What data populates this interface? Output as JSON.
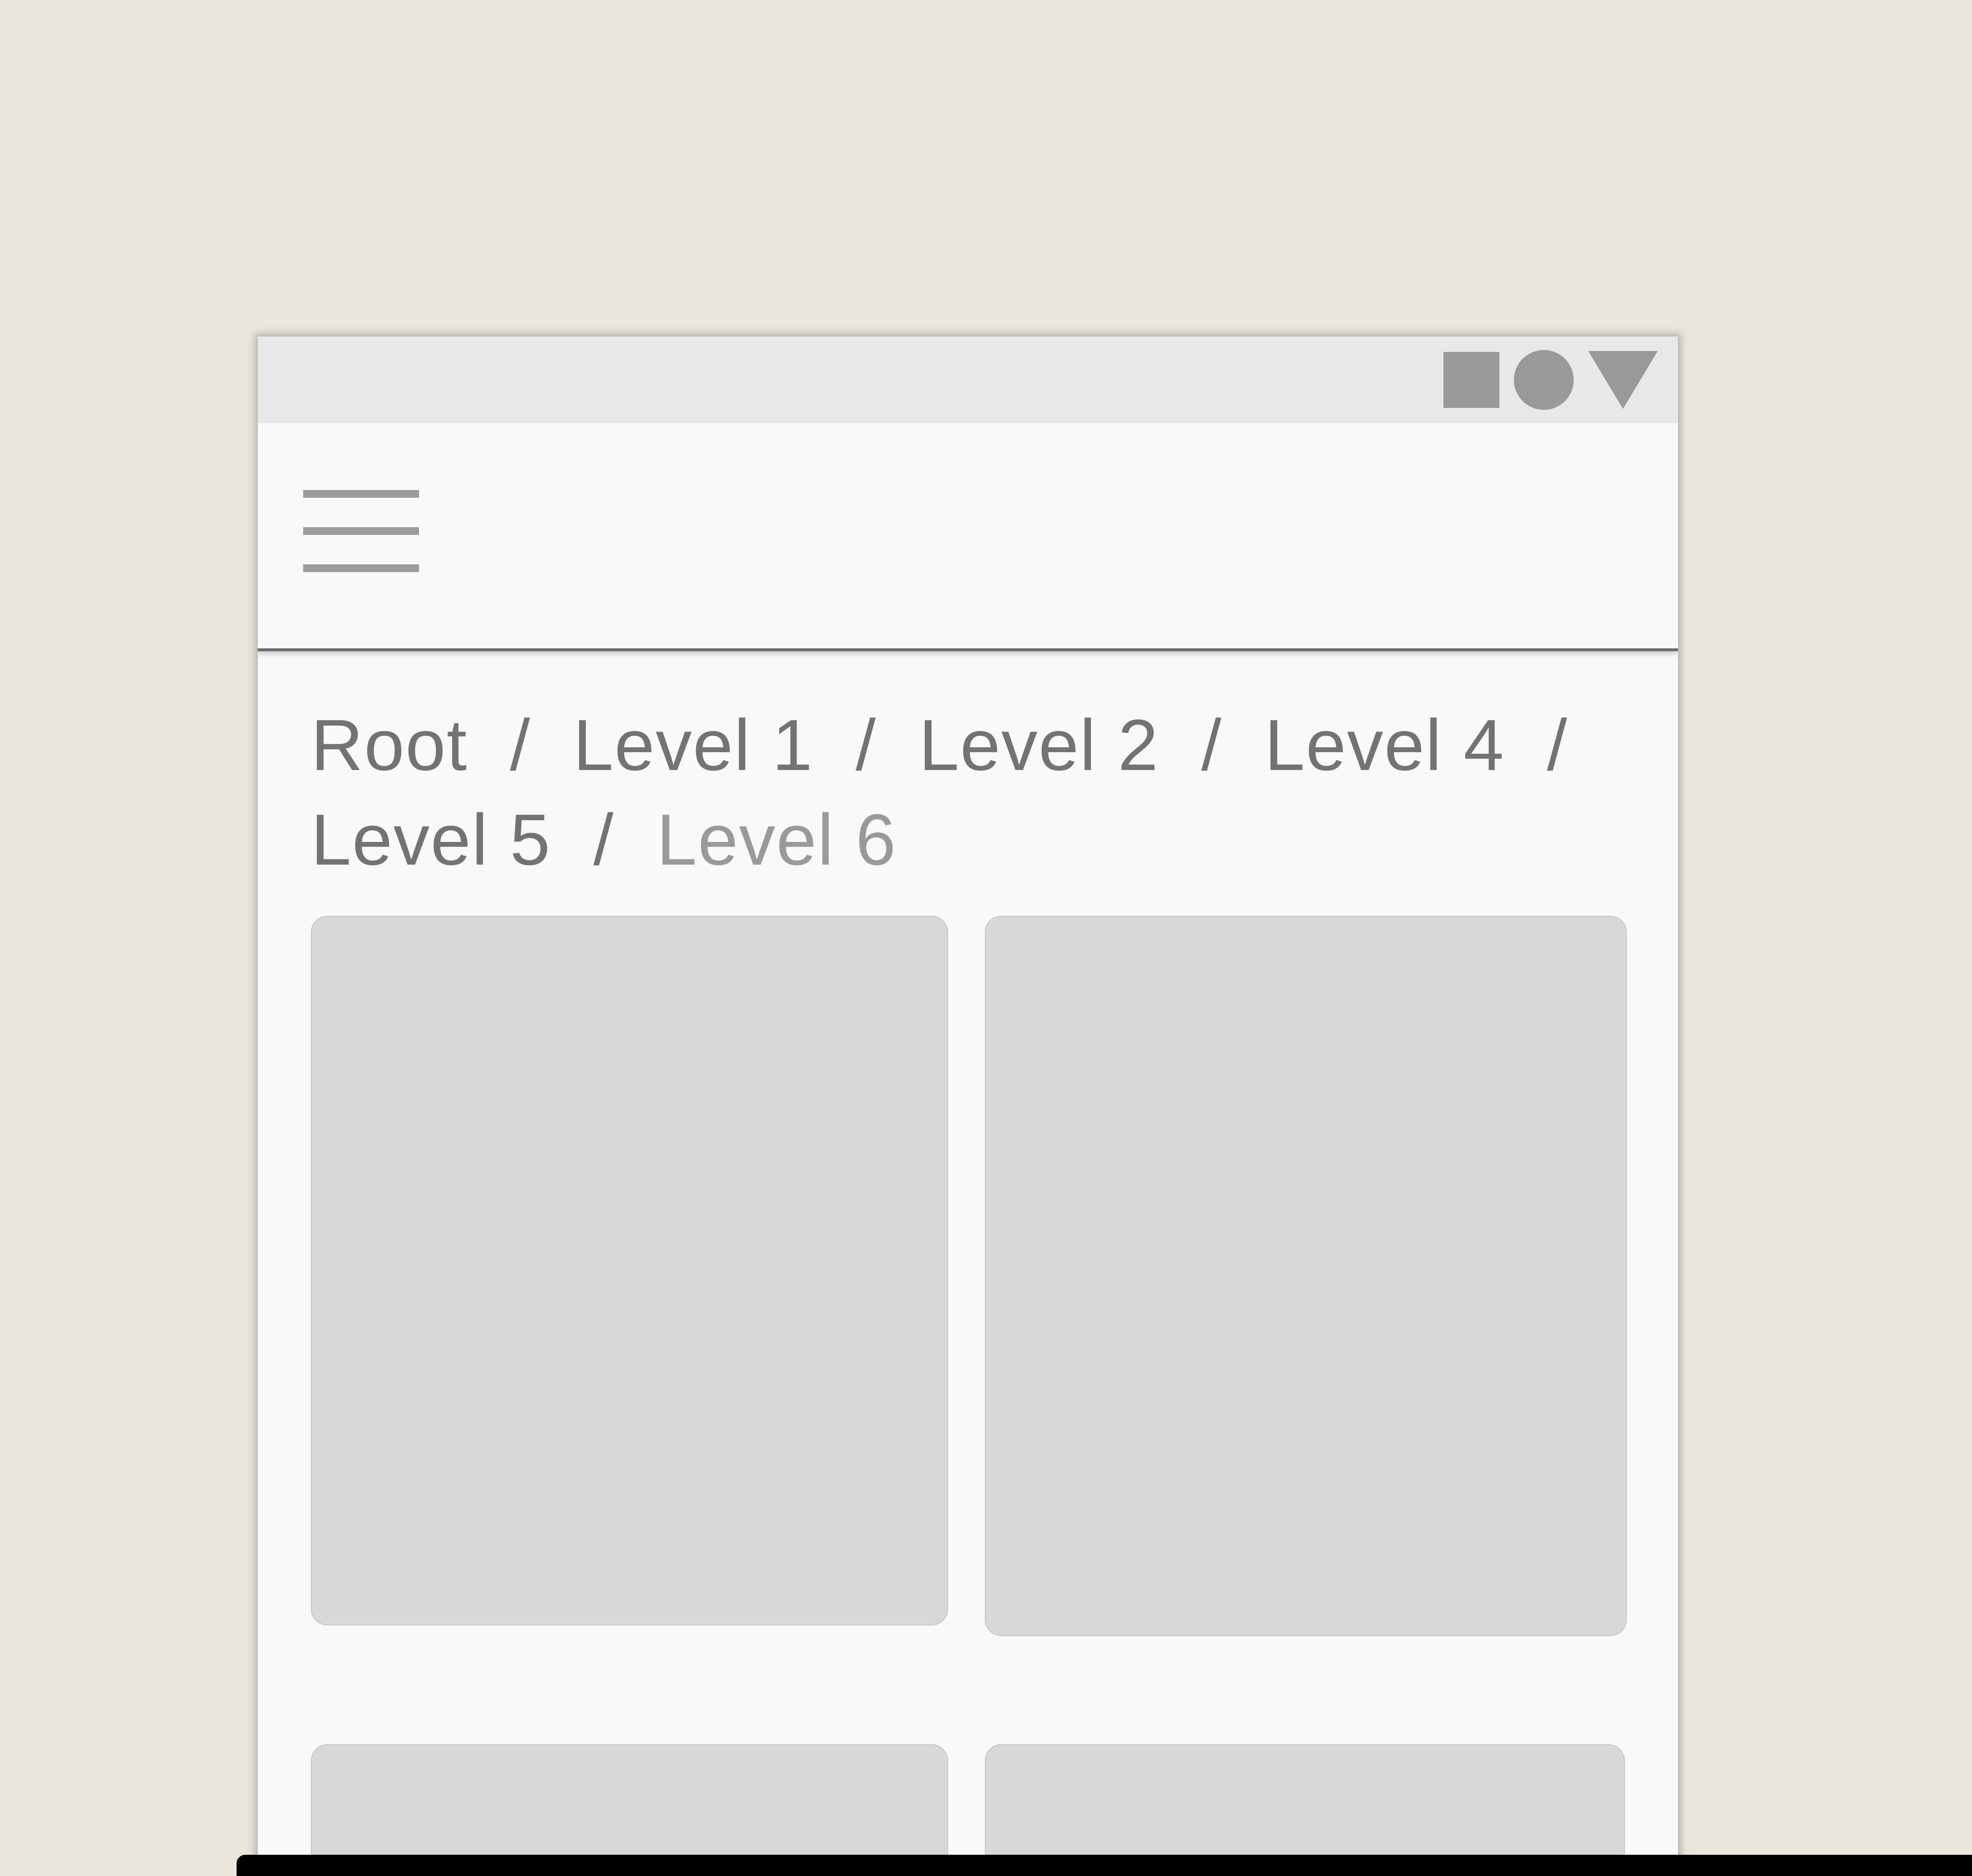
{
  "status_bar": {
    "icons": [
      "square-icon",
      "circle-icon",
      "triangle-icon"
    ],
    "icon_color": "#999999"
  },
  "app_bar": {
    "menu_icon": "hamburger-menu-icon"
  },
  "breadcrumb": {
    "items": [
      "Root",
      "Level 1",
      "Level 2",
      "Level 4",
      "Level 5"
    ],
    "separator": "/",
    "current": "Level 6"
  },
  "cards": [
    {
      "id": "card-1"
    },
    {
      "id": "card-2"
    },
    {
      "id": "card-3"
    },
    {
      "id": "card-4"
    }
  ],
  "colors": {
    "background": "#e9e7db",
    "surface": "#f9f9f9",
    "status_bar": "#e8e8e8",
    "placeholder": "#d8d8d8",
    "text": "#737373",
    "text_current": "#9a9a9a"
  }
}
